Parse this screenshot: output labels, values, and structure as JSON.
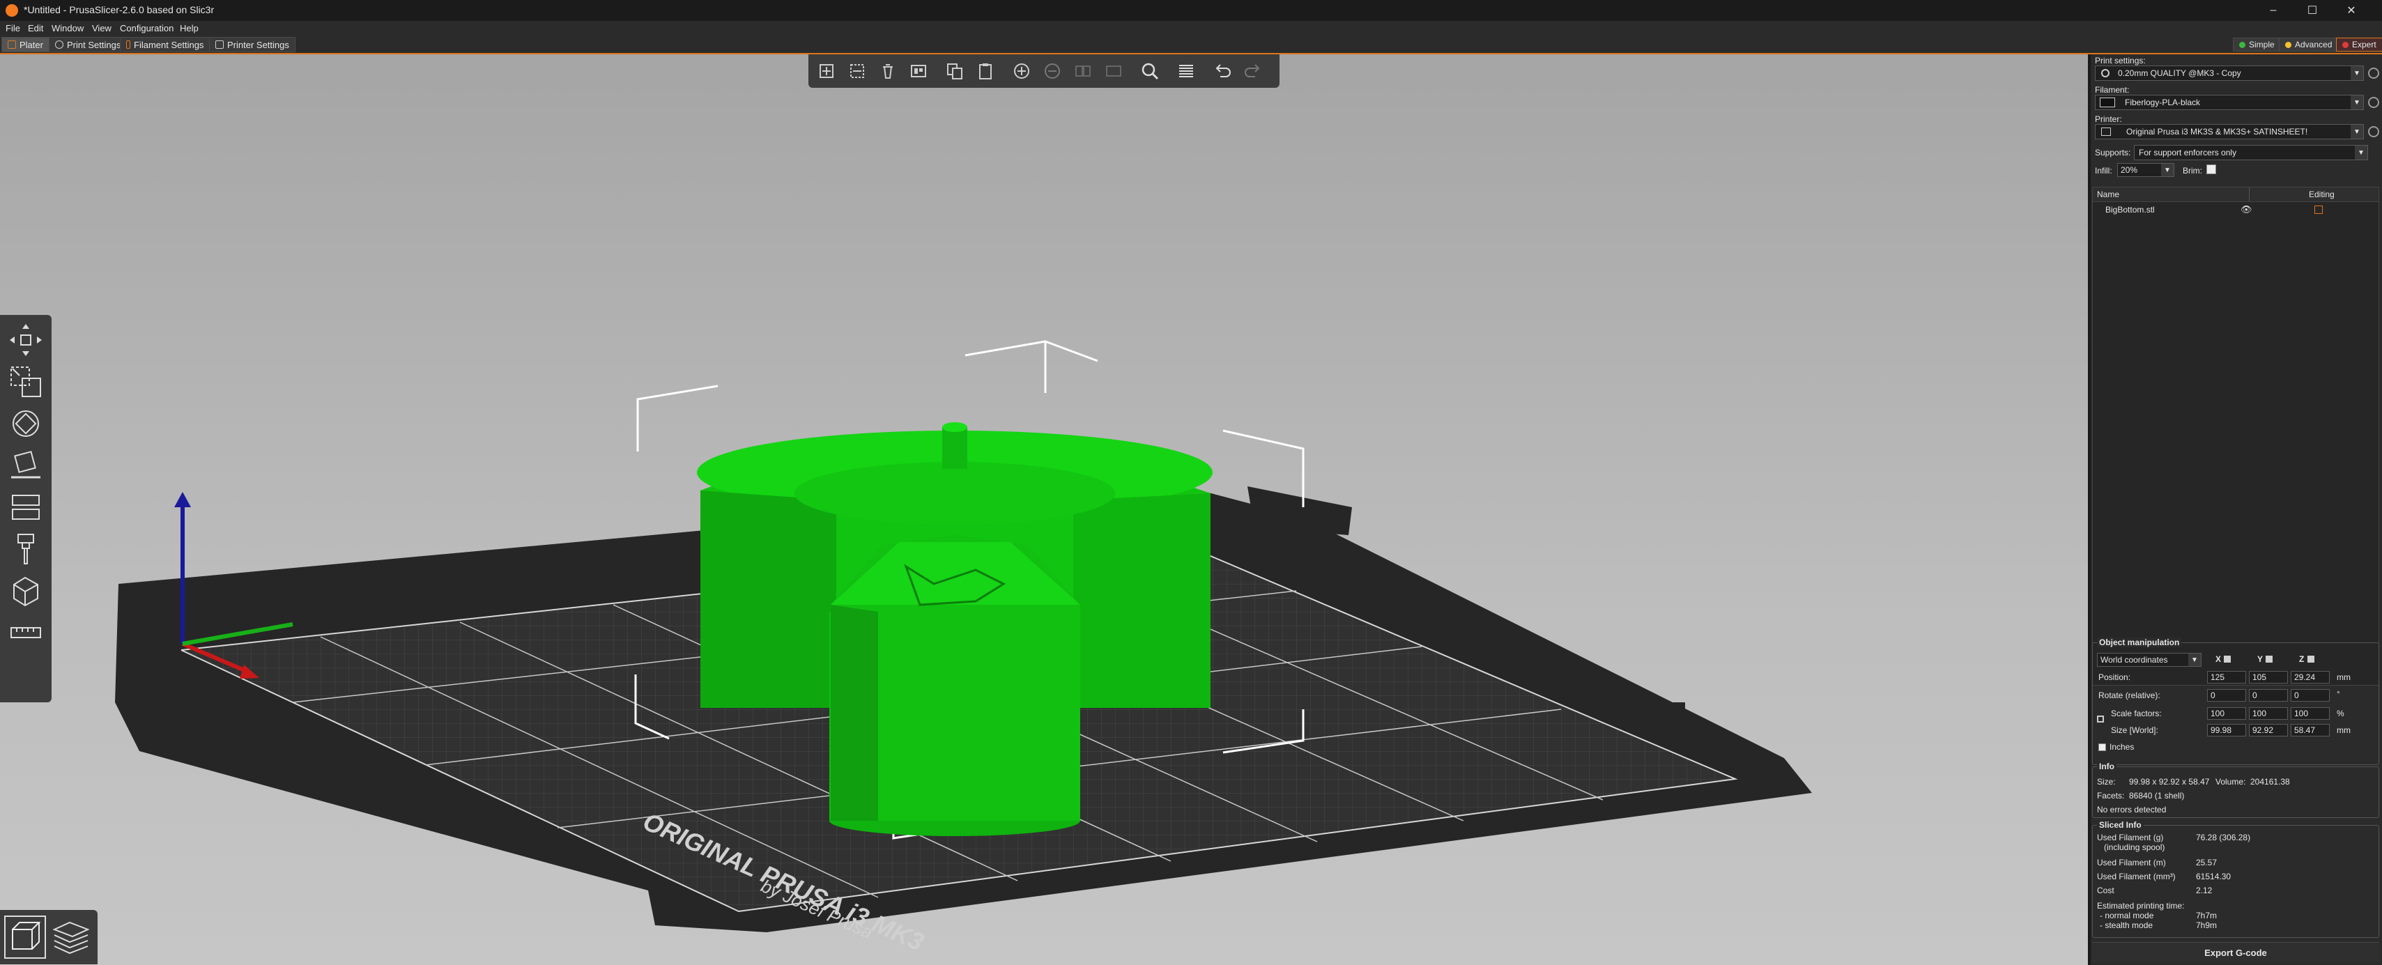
{
  "window": {
    "title": "*Untitled - PrusaSlicer-2.6.0 based on Slic3r",
    "controls": [
      "–",
      "☐",
      "✕"
    ]
  },
  "menu": [
    "File",
    "Edit",
    "Window",
    "View",
    "Configuration",
    "Help"
  ],
  "tabs": [
    "Plater",
    "Print Settings",
    "Filament Settings",
    "Printer Settings"
  ],
  "modes": {
    "simple": "Simple",
    "advanced": "Advanced",
    "expert": "Expert",
    "colors": {
      "simple": "#3cb93c",
      "advanced": "#f2c12e",
      "expert": "#e03b3b"
    }
  },
  "colors": {
    "accent": "#e0751a",
    "model": "#10b510",
    "bed": "#262626"
  },
  "toolbar_top": [
    "add-icon",
    "delete-icon",
    "delete-all-icon",
    "arrange-icon",
    "copy-icon",
    "paste-icon",
    "add-instance-icon",
    "remove-instance-icon",
    "split-objects-icon",
    "split-parts-icon",
    "search-icon",
    "layers-editing-icon",
    "undo-icon",
    "redo-icon"
  ],
  "toolbar_left": [
    "move-icon",
    "scale-icon",
    "rotate-icon",
    "place-on-face-icon",
    "cut-icon",
    "paint-supports-icon",
    "seam-icon",
    "measure-icon"
  ],
  "bed_text": {
    "line1": "ORIGINAL PRUSA i3 MK3",
    "line2": "by Josef Prusa"
  },
  "sidebar": {
    "print_settings_label": "Print settings:",
    "print_settings_value": "0.20mm QUALITY @MK3 - Copy",
    "filament_label": "Filament:",
    "filament_value": "Fiberlogy-PLA-black",
    "printer_label": "Printer:",
    "printer_value": "Original Prusa i3 MK3S & MK3S+ SATINSHEET!",
    "supports_label": "Supports:",
    "supports_value": "For support enforcers only",
    "infill_label": "Infill:",
    "infill_value": "20%",
    "brim_label": "Brim:",
    "objects_header_name": "Name",
    "objects_header_editing": "Editing",
    "objects": [
      {
        "name": "BigBottom.stl"
      }
    ]
  },
  "object_manipulation": {
    "title": "Object manipulation",
    "coord_system": "World coordinates",
    "axes": [
      "X",
      "Y",
      "Z"
    ],
    "position_label": "Position:",
    "position": [
      "125",
      "105",
      "29.24"
    ],
    "position_unit": "mm",
    "rotate_label": "Rotate (relative):",
    "rotate": [
      "0",
      "0",
      "0"
    ],
    "rotate_unit": "°",
    "scale_label": "Scale factors:",
    "scale": [
      "100",
      "100",
      "100"
    ],
    "scale_unit": "%",
    "size_label": "Size [World]:",
    "size": [
      "99.98",
      "92.92",
      "58.47"
    ],
    "size_unit": "mm",
    "inches_label": "Inches"
  },
  "info": {
    "title": "Info",
    "size_label": "Size:",
    "size_value": "99.98 x 92.92 x 58.47",
    "volume_label": "Volume:",
    "volume_value": "204161.38",
    "facets_label": "Facets:",
    "facets_value": "86840 (1 shell)",
    "errors": "No errors detected"
  },
  "sliced_info": {
    "title": "Sliced Info",
    "used_g_label": "Used Filament (g)",
    "used_g_sub": "(including spool)",
    "used_g_value": "76.28 (306.28)",
    "used_m_label": "Used Filament (m)",
    "used_m_value": "25.57",
    "used_mm3_label": "Used Filament (mm³)",
    "used_mm3_value": "61514.30",
    "cost_label": "Cost",
    "cost_value": "2.12",
    "est_label": "Estimated printing time:",
    "normal_label": "- normal mode",
    "normal_value": "7h7m",
    "stealth_label": "- stealth mode",
    "stealth_value": "7h9m"
  },
  "export_button": "Export G-code"
}
